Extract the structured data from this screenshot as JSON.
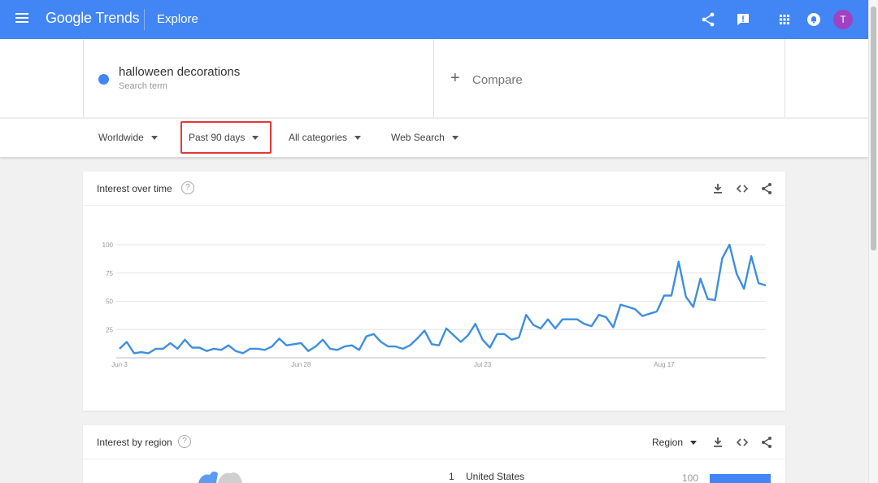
{
  "header": {
    "brand_google": "Google",
    "brand_trends": "Trends",
    "page_title": "Explore",
    "avatar_letter": "T",
    "icons": [
      "menu-icon",
      "share-icon",
      "feedback-icon",
      "apps-grid-icon",
      "notifications-icon"
    ]
  },
  "search_term": {
    "name": "halloween decorations",
    "subtitle": "Search term",
    "color": "#4285f4"
  },
  "compare": {
    "plus": "+",
    "label": "Compare"
  },
  "filters": {
    "region": "Worldwide",
    "time_range": "Past 90 days",
    "category": "All categories",
    "search_type": "Web Search"
  },
  "interest_over_time": {
    "title": "Interest over time",
    "help": "?",
    "actions": [
      "download-icon",
      "embed-icon",
      "share-icon"
    ]
  },
  "chart_data": {
    "type": "line",
    "title": "",
    "xlabel": "",
    "ylabel": "",
    "ylim": [
      0,
      100
    ],
    "y_ticks": [
      25,
      50,
      75,
      100
    ],
    "x_ticks": [
      {
        "label": "Jun 3",
        "index": 0
      },
      {
        "label": "Jun 28",
        "index": 25
      },
      {
        "label": "Jul 23",
        "index": 50
      },
      {
        "label": "Aug 17",
        "index": 75
      }
    ],
    "grid": true,
    "series": [
      {
        "color": "#3d8fe0",
        "values": [
          8,
          14,
          4,
          5,
          4,
          8,
          8,
          13,
          8,
          16,
          9,
          9,
          6,
          8,
          7,
          11,
          6,
          4,
          8,
          8,
          7,
          10,
          17,
          11,
          12,
          13,
          6,
          10,
          16,
          8,
          7,
          10,
          11,
          7,
          19,
          21,
          14,
          10,
          10,
          8,
          11,
          17,
          24,
          12,
          11,
          26,
          20,
          14,
          20,
          30,
          16,
          9,
          21,
          21,
          16,
          18,
          38,
          29,
          26,
          34,
          26,
          34,
          34,
          34,
          30,
          28,
          38,
          36,
          27,
          47,
          45,
          43,
          37,
          39,
          41,
          55,
          55,
          85,
          54,
          45,
          70,
          52,
          51,
          88,
          100,
          74,
          61,
          90,
          66,
          64
        ]
      }
    ]
  },
  "interest_by_region": {
    "title": "Interest by region",
    "help": "?",
    "region_select": "Region",
    "actions": [
      "download-icon",
      "embed-icon",
      "share-icon"
    ],
    "rows": [
      {
        "rank": "1",
        "country": "United States",
        "value": "100",
        "fraction": 1.0
      }
    ]
  }
}
